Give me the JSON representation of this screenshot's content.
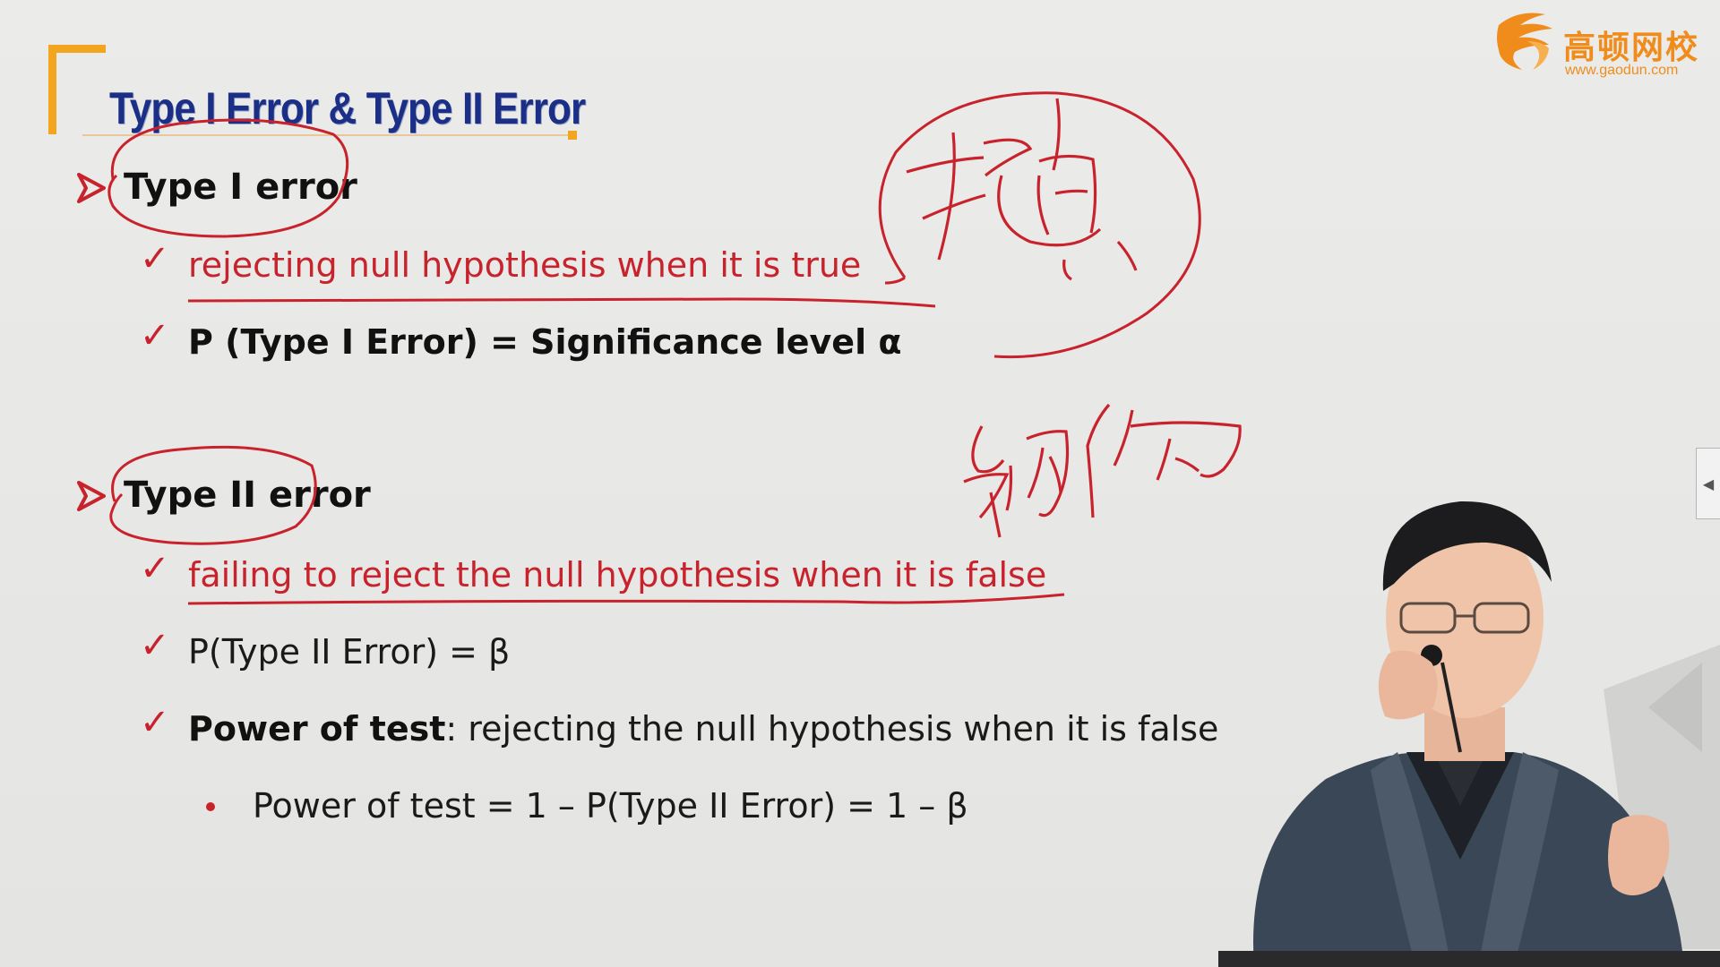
{
  "slide": {
    "title": "Type I Error & Type II Error",
    "logo": {
      "brand_cn": "高顿网校",
      "url": "www.gaodun.com",
      "accent_color": "#f08c1c"
    },
    "sections": [
      {
        "heading": "Type I error",
        "points": [
          "rejecting null hypothesis when it is true",
          "P (Type I Error) = Significance level α"
        ]
      },
      {
        "heading": "Type II error",
        "points": [
          "failing to reject the null hypothesis when it is false",
          "P(Type II Error) = β"
        ],
        "power": {
          "label": "Power of test",
          "text": ": rejecting the null hypothesis when it is false",
          "sub": "Power of test = 1 – P(Type II Error) = 1 – β"
        }
      }
    ],
    "handwriting": {
      "note_1": "拒真",
      "note_2": "纳伪"
    },
    "colors": {
      "title": "#1b2f86",
      "highlight": "#c8232c",
      "bracket": "#f2a51f"
    }
  },
  "side_tab_icon": "collapse-left-icon"
}
